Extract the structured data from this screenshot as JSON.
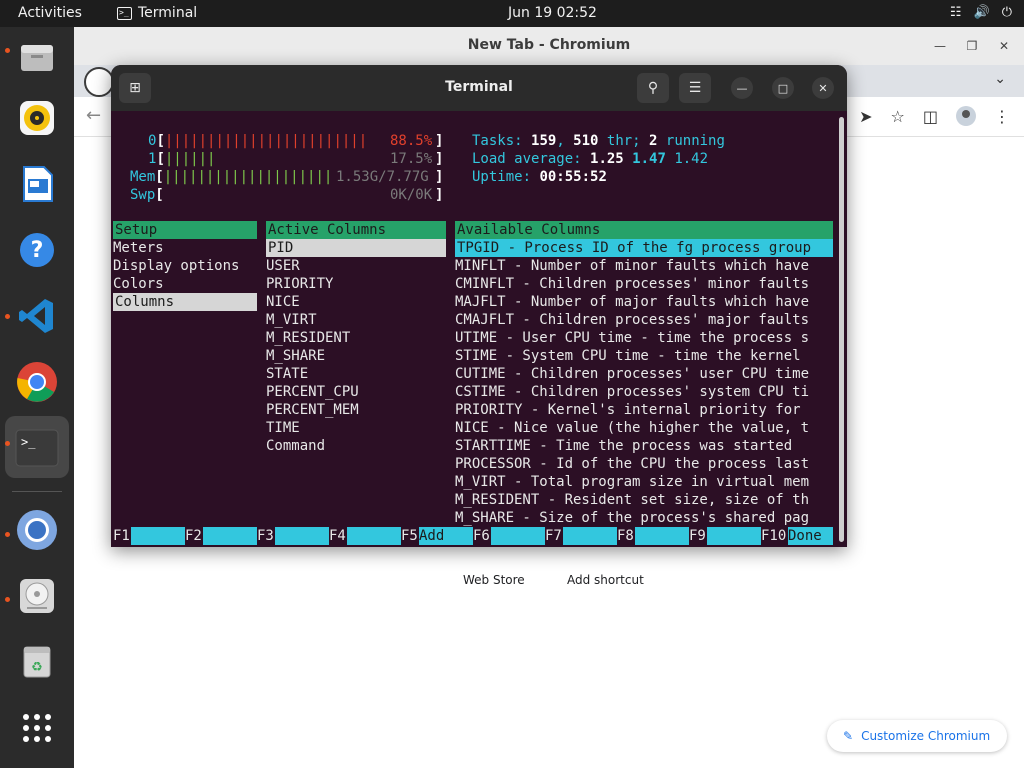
{
  "topbar": {
    "activities": "Activities",
    "app_name": "Terminal",
    "clock": "Jun 19  02:52"
  },
  "chromium": {
    "title": "New Tab - Chromium",
    "webstore": "Web Store",
    "add_shortcut": "Add shortcut",
    "customize": "Customize Chromium"
  },
  "terminal": {
    "title": "Terminal",
    "meters": {
      "cpu0_label": "0",
      "cpu0_bars": "||||||||||||||||||||||||",
      "cpu0_value": "88.5%",
      "cpu1_label": "1",
      "cpu1_bars": "||||||",
      "cpu1_value": "17.5%",
      "mem_label": "Mem",
      "mem_bars": "||||||||||||||||||||",
      "mem_value": "1.53G/7.77G",
      "swp_label": "Swp",
      "swp_value": "0K/0K"
    },
    "stats": {
      "tasks_label": "Tasks: ",
      "tasks_count": "159",
      "tasks_sep": ", ",
      "threads_count": "510",
      "threads_label": " thr; ",
      "running_count": "2",
      "running_label": " running",
      "load_label": "Load average: ",
      "load1": "1.25",
      "load5": "1.47",
      "load15": "1.42",
      "uptime_label": "Uptime: ",
      "uptime": "00:55:52"
    },
    "setup": {
      "header": "Setup",
      "items": [
        "Meters",
        "Display options",
        "Colors",
        "Columns"
      ],
      "selected": "Columns"
    },
    "active_columns": {
      "header": "Active Columns",
      "items": [
        "PID",
        "USER",
        "PRIORITY",
        "NICE",
        "M_VIRT",
        "M_RESIDENT",
        "M_SHARE",
        "STATE",
        "PERCENT_CPU",
        "PERCENT_MEM",
        "TIME",
        "Command"
      ]
    },
    "available_columns": {
      "header": "Available Columns",
      "items": [
        "TPGID - Process ID of the fg process group",
        "MINFLT - Number of minor faults which have",
        "CMINFLT - Children processes' minor faults",
        "MAJFLT - Number of major faults which have",
        "CMAJFLT - Children processes' major faults",
        "UTIME - User CPU time - time the process s",
        "STIME - System CPU time - time the kernel",
        "CUTIME - Children processes' user CPU time",
        "CSTIME - Children processes' system CPU ti",
        "PRIORITY - Kernel's internal priority for",
        "NICE - Nice value (the higher the value, t",
        "STARTTIME - Time the process was started",
        "PROCESSOR - Id of the CPU the process last",
        "M_VIRT - Total program size in virtual mem",
        "M_RESIDENT - Resident set size, size of th",
        "M_SHARE - Size of the process's shared pag"
      ]
    },
    "function_keys": [
      {
        "key": "F1",
        "label": ""
      },
      {
        "key": "F2",
        "label": ""
      },
      {
        "key": "F3",
        "label": ""
      },
      {
        "key": "F4",
        "label": ""
      },
      {
        "key": "F5",
        "label": "Add"
      },
      {
        "key": "F6",
        "label": ""
      },
      {
        "key": "F7",
        "label": ""
      },
      {
        "key": "F8",
        "label": ""
      },
      {
        "key": "F9",
        "label": ""
      },
      {
        "key": "F10",
        "label": "Done"
      }
    ]
  },
  "colors": {
    "terminal_bg": "#2c0f25",
    "accent_green": "#26a269",
    "accent_cyan": "#33c7de",
    "ubuntu_orange": "#e95420"
  },
  "dock_icons": [
    "files-icon",
    "rhythmbox-icon",
    "writer-icon",
    "help-icon",
    "vscode-icon",
    "chrome-icon",
    "terminal-icon",
    "chromium-icon",
    "disk-icon",
    "trash-icon",
    "app-grid-icon"
  ]
}
